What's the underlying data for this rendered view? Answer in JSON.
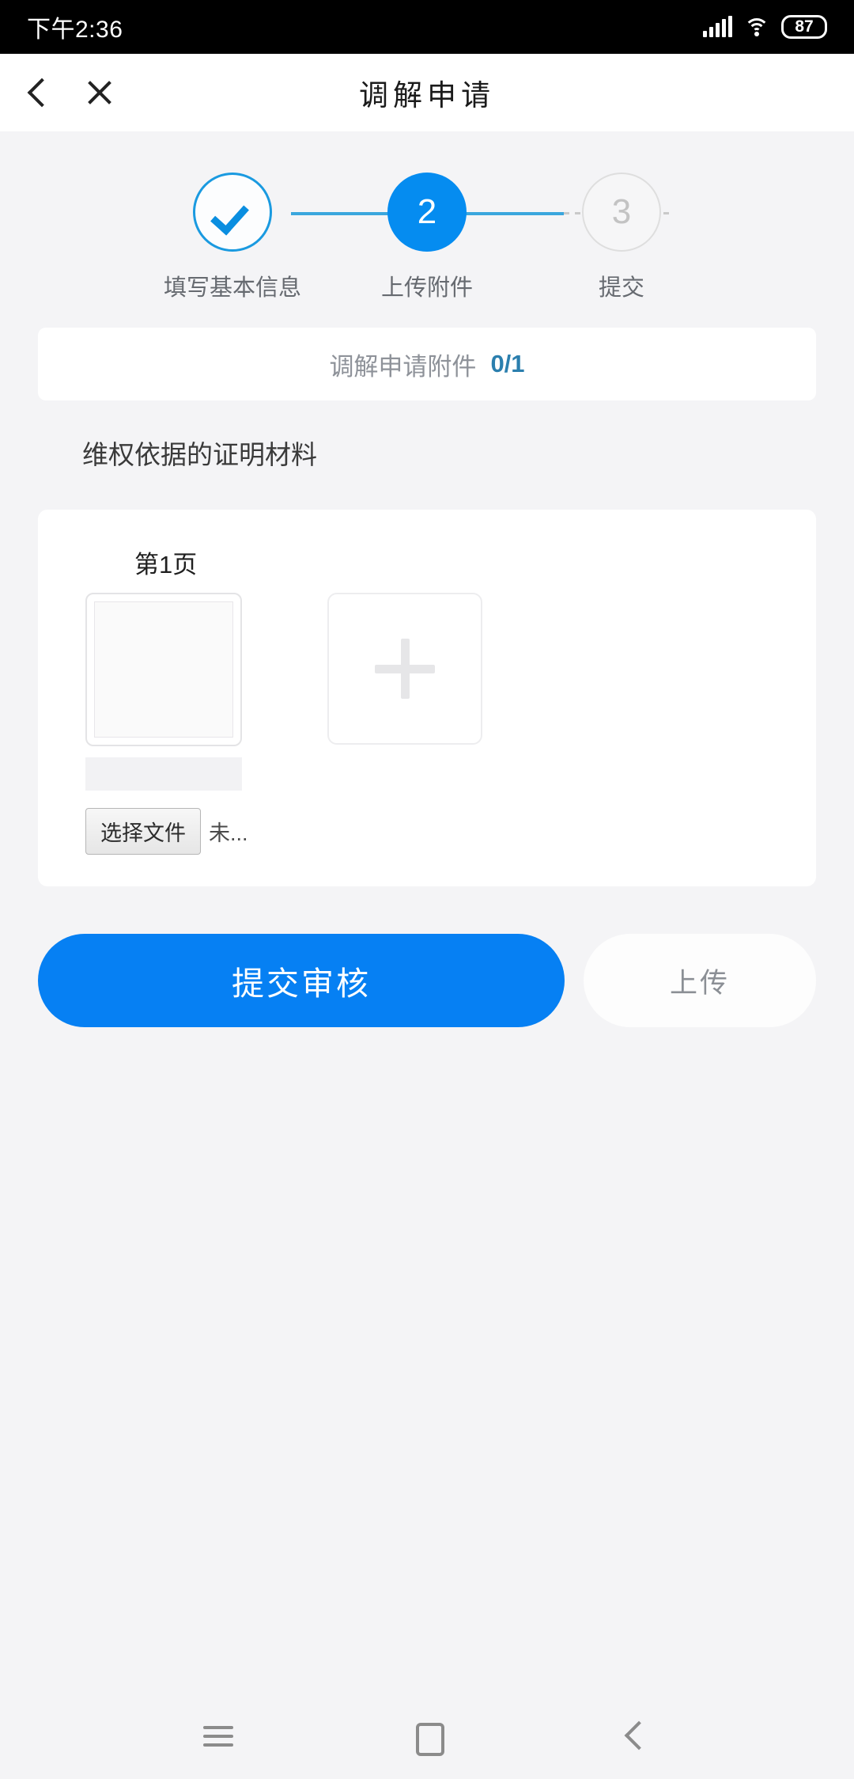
{
  "status_bar": {
    "time": "下午2:36",
    "battery": "87",
    "signal_icon": "signal-bars-icon",
    "wifi_icon": "wifi-icon",
    "battery_icon": "battery-icon"
  },
  "header": {
    "title": "调解申请",
    "back_icon": "chevron-left-icon",
    "close_icon": "close-icon"
  },
  "stepper": {
    "steps": [
      {
        "index": "1",
        "marker": "✔",
        "label": "填写基本信息",
        "state": "done"
      },
      {
        "index": "2",
        "marker": "2",
        "label": "上传附件",
        "state": "active"
      },
      {
        "index": "3",
        "marker": "3",
        "label": "提交",
        "state": "todo"
      }
    ]
  },
  "attachment_summary": {
    "title": "调解申请附件",
    "count": "0/1"
  },
  "section": {
    "title": "维权依据的证明材料"
  },
  "upload": {
    "page_label": "第1页",
    "thumbnail_placeholder": "image-placeholder",
    "add_tile_icon": "plus-icon",
    "file_input": {
      "button_label": "选择文件",
      "file_name": "未..."
    }
  },
  "actions": {
    "primary_label": "提交审核",
    "secondary_label": "上传"
  },
  "nav_bar": {
    "menu_icon": "menu-icon",
    "home_icon": "home-icon",
    "back_icon": "back-icon"
  },
  "colors": {
    "accent_blue": "#058cf0",
    "primary_button": "#0680f3",
    "count_blue": "#2b7fae",
    "page_bg": "#f4f4f6"
  }
}
